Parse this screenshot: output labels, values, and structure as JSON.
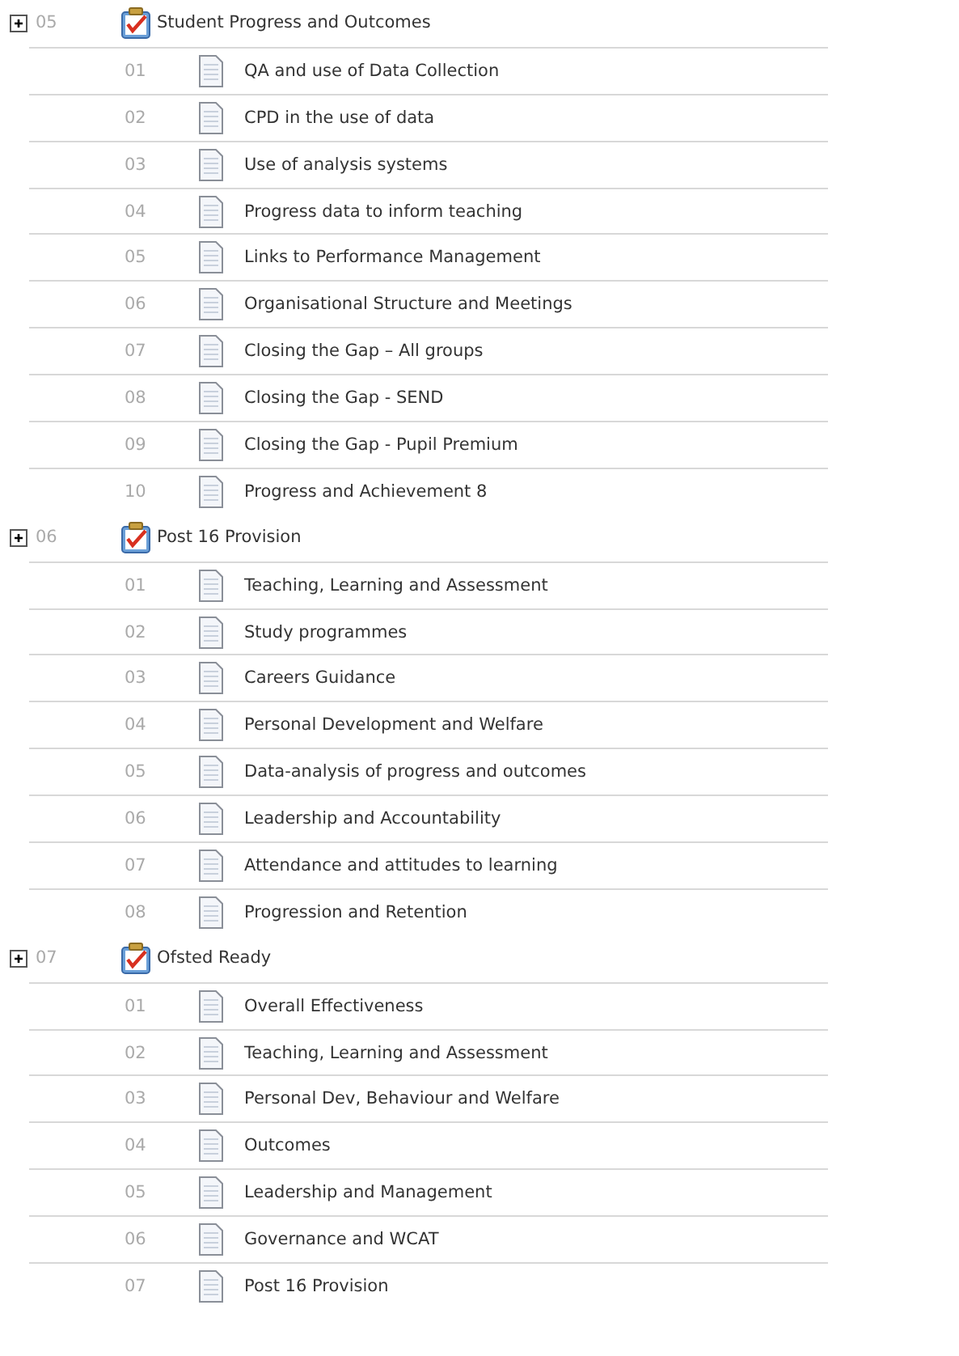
{
  "sections": [
    {
      "number": "05",
      "title": "Student Progress and Outcomes",
      "children": [
        {
          "number": "01",
          "title": "QA and use of Data Collection"
        },
        {
          "number": "02",
          "title": "CPD in the use of data"
        },
        {
          "number": "03",
          "title": "Use of analysis systems"
        },
        {
          "number": "04",
          "title": "Progress data to inform teaching"
        },
        {
          "number": "05",
          "title": "Links to Performance Management"
        },
        {
          "number": "06",
          "title": "Organisational Structure and Meetings"
        },
        {
          "number": "07",
          "title": "Closing the Gap – All groups"
        },
        {
          "number": "08",
          "title": "Closing the Gap - SEND"
        },
        {
          "number": "09",
          "title": "Closing the Gap - Pupil Premium"
        },
        {
          "number": "10",
          "title": "Progress and Achievement 8"
        }
      ]
    },
    {
      "number": "06",
      "title": "Post 16 Provision",
      "children": [
        {
          "number": "01",
          "title": "Teaching, Learning and Assessment"
        },
        {
          "number": "02",
          "title": "Study programmes"
        },
        {
          "number": "03",
          "title": "Careers Guidance"
        },
        {
          "number": "04",
          "title": "Personal Development and Welfare"
        },
        {
          "number": "05",
          "title": "Data-analysis of progress and outcomes"
        },
        {
          "number": "06",
          "title": "Leadership and Accountability"
        },
        {
          "number": "07",
          "title": "Attendance and attitudes to learning"
        },
        {
          "number": "08",
          "title": "Progression and Retention"
        }
      ]
    },
    {
      "number": "07",
      "title": "Ofsted Ready",
      "children": [
        {
          "number": "01",
          "title": "Overall Effectiveness"
        },
        {
          "number": "02",
          "title": "Teaching, Learning and Assessment"
        },
        {
          "number": "03",
          "title": "Personal Dev, Behaviour and Welfare"
        },
        {
          "number": "04",
          "title": "Outcomes"
        },
        {
          "number": "05",
          "title": "Leadership and Management"
        },
        {
          "number": "06",
          "title": "Governance and WCAT"
        },
        {
          "number": "07",
          "title": "Post 16 Provision"
        }
      ]
    }
  ]
}
